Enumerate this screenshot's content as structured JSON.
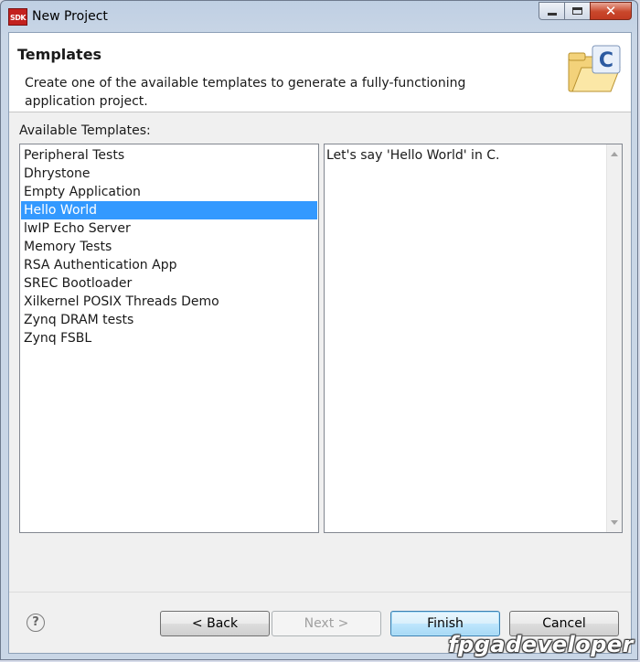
{
  "window": {
    "title": "New Project",
    "app_icon_text": "SDK",
    "icons": {
      "minimize": "minimize-icon",
      "maximize": "maximize-icon",
      "close": "close-icon"
    }
  },
  "banner": {
    "title": "Templates",
    "description": "Create one of the available templates to generate a fully-functioning application project.",
    "icon": "c-project-folder-icon"
  },
  "templates": {
    "label": "Available Templates:",
    "items": [
      "Peripheral Tests",
      "Dhrystone",
      "Empty Application",
      "Hello World",
      "lwIP Echo Server",
      "Memory Tests",
      "RSA Authentication App",
      "SREC Bootloader",
      "Xilkernel POSIX Threads Demo",
      "Zynq DRAM tests",
      "Zynq FSBL"
    ],
    "selected": "Hello World",
    "description": "Let's say 'Hello World' in C."
  },
  "buttons": {
    "help": "?",
    "back": "< Back",
    "next": "Next >",
    "finish": "Finish",
    "cancel": "Cancel"
  },
  "watermark": "fpgadeveloper"
}
